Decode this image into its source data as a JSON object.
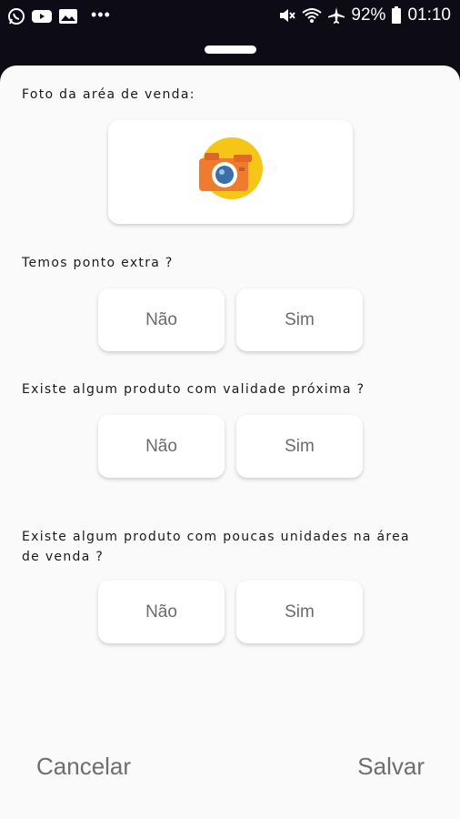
{
  "status_bar": {
    "battery": "92%",
    "time": "01:10",
    "overflow": "•••"
  },
  "form": {
    "photo_label": "Foto da aréa de venda:",
    "questions": [
      {
        "label": "Temos ponto extra ?",
        "no": "Não",
        "yes": "Sim"
      },
      {
        "label": "Existe algum produto com validade próxima ?",
        "no": "Não",
        "yes": "Sim"
      },
      {
        "label": "Existe algum produto com poucas unidades na área de venda ?",
        "no": "Não",
        "yes": "Sim"
      }
    ]
  },
  "actions": {
    "cancel": "Cancelar",
    "save": "Salvar"
  },
  "icons": {
    "camera": "camera-icon",
    "whatsapp": "whatsapp-icon",
    "youtube": "youtube-icon",
    "gallery": "gallery-icon",
    "mute": "mute-icon",
    "wifi": "wifi-icon",
    "airplane": "airplane-icon",
    "battery": "battery-icon"
  },
  "colors": {
    "camera_badge": "#f5c518",
    "camera_body": "#f07a2e",
    "camera_lens": "#3a6fa8"
  }
}
